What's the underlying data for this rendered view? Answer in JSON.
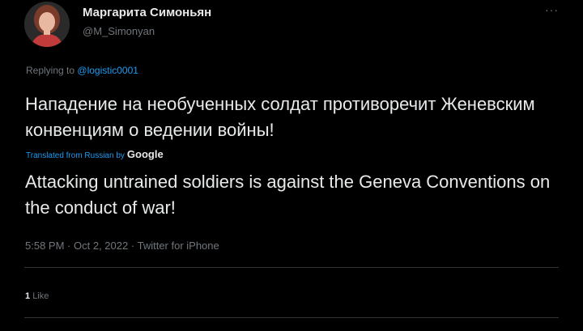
{
  "author": {
    "display_name": "Маргарита Симоньян",
    "handle": "@M_Simonyan",
    "avatar_icon": "profile-photo",
    "more_label": "···"
  },
  "reply": {
    "prefix": "Replying to",
    "mention": "@logistic0001"
  },
  "tweet": {
    "original_text": "Нападение на необученных солдат противоречит Женевским конвенциям о ведении войны!",
    "translated_label": "Translated from Russian by",
    "translator": "Google",
    "translated_text": "Attacking untrained soldiers is against the Geneva Conventions on the conduct of war!"
  },
  "meta": {
    "time": "5:58 PM",
    "date": "Oct 2, 2022",
    "client": "Twitter for iPhone",
    "separator": "·"
  },
  "stats": {
    "likes_count": "1",
    "likes_label": "Like"
  },
  "colors": {
    "background": "#000000",
    "text_primary": "#e7e9ea",
    "text_secondary": "#71767b",
    "accent": "#1d9bf0",
    "divider": "#2f3336"
  }
}
